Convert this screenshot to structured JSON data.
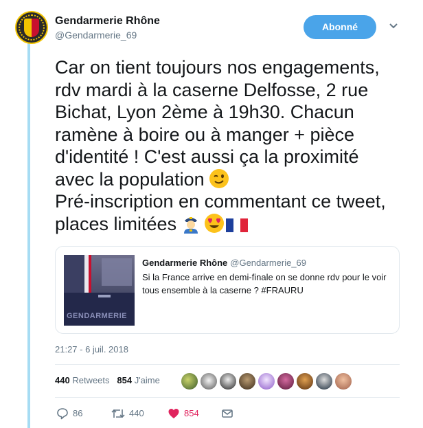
{
  "account": {
    "name": "Gendarmerie Rhône",
    "handle": "@Gendarmerie_69",
    "avatar_icon": "gendarmerie-crest"
  },
  "follow_button": {
    "label": "Abonné",
    "color": "#4aa4e9"
  },
  "tweet": {
    "lines": [
      "Car on tient toujours nos engagements,",
      "rdv mardi à la caserne Delfosse, 2 rue",
      "Bichat, Lyon 2ème à 19h30. Chacun",
      "ramène à boire ou à manger + pièce",
      "d'identité ! C'est aussi ça la proximité",
      "avec la population",
      "Pré-inscription en commentant ce tweet,",
      "places limitées"
    ],
    "emoji": [
      "winking-face",
      "police-officer",
      "heart-eyes-face",
      "france-flag"
    ]
  },
  "quote": {
    "name": "Gendarmerie Rhône",
    "handle": "@Gendarmerie_69",
    "text": "Si la France arrive en demi-finale on se donne rdv pour le voir tous ensemble à la caserne ? #FRAURU",
    "image_caption": "GENDARMERIE"
  },
  "timestamp": "21:27 - 6 juil. 2018",
  "stats": {
    "retweets_count": "440",
    "retweets_label": "Retweets",
    "likes_count": "854",
    "likes_label": "J'aime"
  },
  "actions": {
    "replies": "86",
    "retweets": "440",
    "likes": "854"
  },
  "colors": {
    "accent": "#4aa4e9",
    "thread_line": "#a6dcf3",
    "like": "#e0245e",
    "muted": "#657786"
  }
}
